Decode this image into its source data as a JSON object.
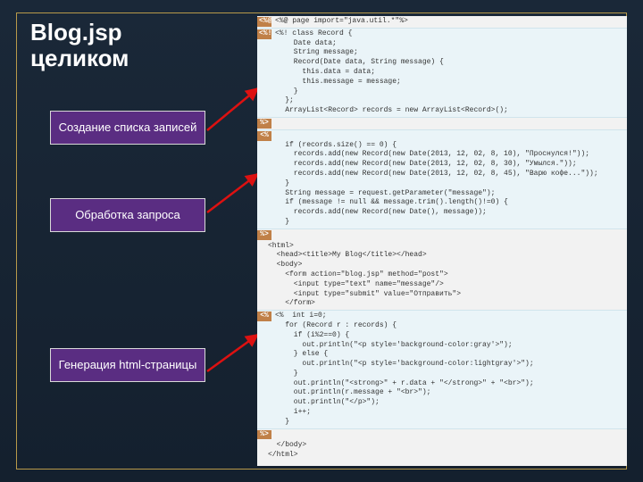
{
  "title_line1": "Blog.jsp",
  "title_line2": "целиком",
  "callouts": {
    "c1": "Создание списка записей",
    "c2": "Обработка запроса",
    "c3": "Генерация html-страницы"
  },
  "code": {
    "l01": "<%@ page import=\"java.util.*\"%>",
    "l02": "<%! class Record {",
    "l03": "      Date data;",
    "l04": "      String message;",
    "l05": "      Record(Date data, String message) {",
    "l06": "        this.data = data;",
    "l07": "        this.message = message;",
    "l08": "      }",
    "l09": "    };",
    "l10": "    ArrayList<Record> records = new ArrayList<Record>();",
    "l11": "%>",
    "l12": "<%",
    "l13": "    if (records.size() == 0) {",
    "l14": "      records.add(new Record(new Date(2013, 12, 02, 8, 10), \"Проснулся!\"));",
    "l15": "      records.add(new Record(new Date(2013, 12, 02, 8, 30), \"Умылся.\"));",
    "l16": "      records.add(new Record(new Date(2013, 12, 02, 8, 45), \"Варю кофе...\"));",
    "l17": "    }",
    "l18": "",
    "l19": "    String message = request.getParameter(\"message\");",
    "l20": "    if (message != null && message.trim().length()!=0) {",
    "l21": "      records.add(new Record(new Date(), message));",
    "l22": "    }",
    "l23": "%>",
    "l24": "<html>",
    "l25": "  <head><title>My Blog</title></head>",
    "l26": "  <body>",
    "l27": "    <form action=\"blog.jsp\" method=\"post\">",
    "l28": "      <input type=\"text\" name=\"message\"/>",
    "l29": "      <input type=\"submit\" value=\"Отправить\">",
    "l30": "    </form>",
    "l31": "<%  int i=0;",
    "l32": "    for (Record r : records) {",
    "l33": "      if (i%2==0) {",
    "l34": "        out.println(\"<p style='background-color:gray'>\");",
    "l35": "      } else {",
    "l36": "        out.println(\"<p style='background-color:lightgray'>\");",
    "l37": "      }",
    "l38": "      out.println(\"<strong>\" + r.data + \"</strong>\" + \"<br>\");",
    "l39": "      out.println(r.message + \"<br>\");",
    "l40": "      out.println(\"</p>\");",
    "l41": "      i++;",
    "l42": "    }",
    "l43": "%>",
    "l44": "  </body>",
    "l45": "</html>"
  }
}
